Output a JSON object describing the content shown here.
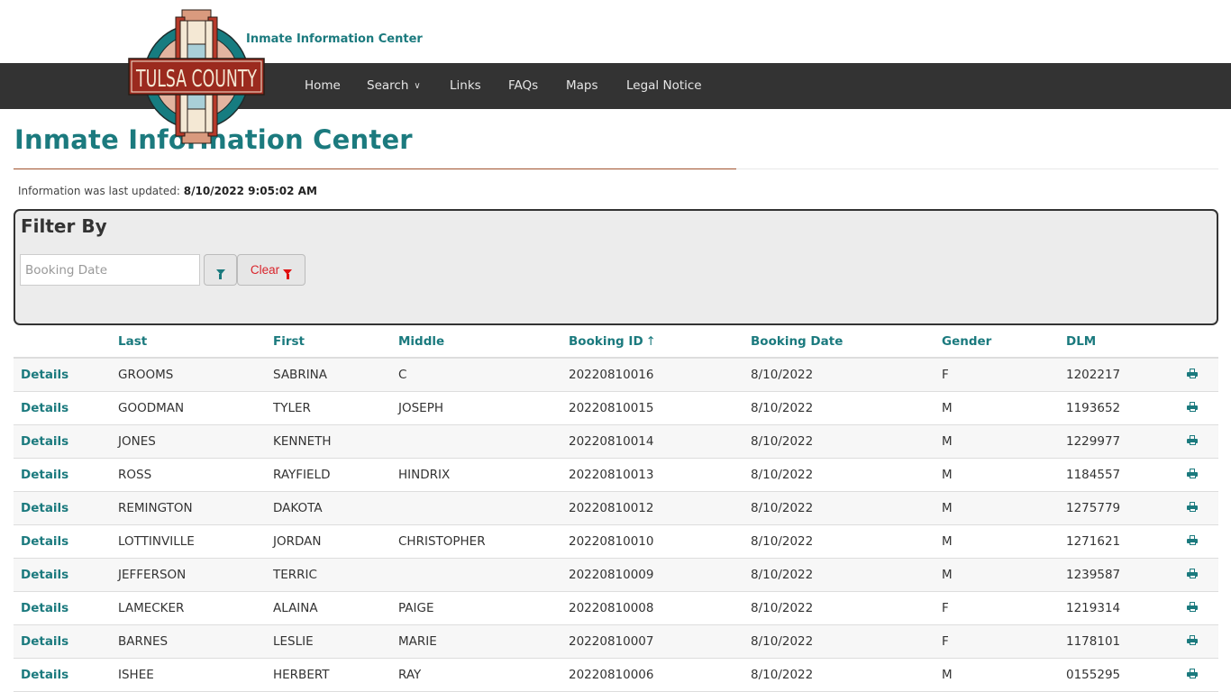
{
  "header": {
    "logo_text": "TULSA COUNTY",
    "site_subtitle": "Inmate Information Center"
  },
  "nav": {
    "items": [
      {
        "label": "Home"
      },
      {
        "label": "Search",
        "has_dropdown": true
      },
      {
        "label": "Links"
      },
      {
        "label": "FAQs"
      },
      {
        "label": "Maps"
      },
      {
        "label": "Legal Notice"
      }
    ],
    "chevron": "⌄"
  },
  "page": {
    "title": "Inmate Information Center",
    "updated_label": "Information was last updated:",
    "updated_value": "8/10/2022 9:05:02 AM"
  },
  "filter": {
    "title": "Filter By",
    "date_placeholder": "Booking Date",
    "date_value": "",
    "filter_button_icon": "filter-icon",
    "clear_label": "Clear",
    "clear_icon": "filter-icon"
  },
  "table": {
    "columns": [
      "",
      "Last",
      "First",
      "Middle",
      "Booking ID",
      "Booking Date",
      "Gender",
      "DLM",
      ""
    ],
    "sort_column": "Booking ID",
    "sort_indicator": "↑",
    "details_label": "Details",
    "row_action_icon": "print-icon",
    "rows": [
      {
        "last": "GROOMS",
        "first": "SABRINA",
        "middle": "C",
        "booking_id": "20220810016",
        "booking_date": "8/10/2022",
        "gender": "F",
        "dlm": "1202217"
      },
      {
        "last": "GOODMAN",
        "first": "TYLER",
        "middle": "JOSEPH",
        "booking_id": "20220810015",
        "booking_date": "8/10/2022",
        "gender": "M",
        "dlm": "1193652"
      },
      {
        "last": "JONES",
        "first": "KENNETH",
        "middle": "",
        "booking_id": "20220810014",
        "booking_date": "8/10/2022",
        "gender": "M",
        "dlm": "1229977"
      },
      {
        "last": "ROSS",
        "first": "RAYFIELD",
        "middle": "HINDRIX",
        "booking_id": "20220810013",
        "booking_date": "8/10/2022",
        "gender": "M",
        "dlm": "1184557"
      },
      {
        "last": "REMINGTON",
        "first": "DAKOTA",
        "middle": "",
        "booking_id": "20220810012",
        "booking_date": "8/10/2022",
        "gender": "M",
        "dlm": "1275779"
      },
      {
        "last": "LOTTINVILLE",
        "first": "JORDAN",
        "middle": "CHRISTOPHER",
        "booking_id": "20220810010",
        "booking_date": "8/10/2022",
        "gender": "M",
        "dlm": "1271621"
      },
      {
        "last": "JEFFERSON",
        "first": "TERRIC",
        "middle": "",
        "booking_id": "20220810009",
        "booking_date": "8/10/2022",
        "gender": "M",
        "dlm": "1239587"
      },
      {
        "last": "LAMECKER",
        "first": "ALAINA",
        "middle": "PAIGE",
        "booking_id": "20220810008",
        "booking_date": "8/10/2022",
        "gender": "F",
        "dlm": "1219314"
      },
      {
        "last": "BARNES",
        "first": "LESLIE",
        "middle": "MARIE",
        "booking_id": "20220810007",
        "booking_date": "8/10/2022",
        "gender": "F",
        "dlm": "1178101"
      },
      {
        "last": "ISHEE",
        "first": "HERBERT",
        "middle": "RAY",
        "booking_id": "20220810006",
        "booking_date": "8/10/2022",
        "gender": "M",
        "dlm": "0155295"
      }
    ]
  },
  "colors": {
    "brand_teal": "#1b7a7e",
    "nav_bg": "#333333",
    "rule_brown": "#a0522d",
    "clear_red": "#d9232a",
    "logo_red": "#9b2a1e"
  }
}
